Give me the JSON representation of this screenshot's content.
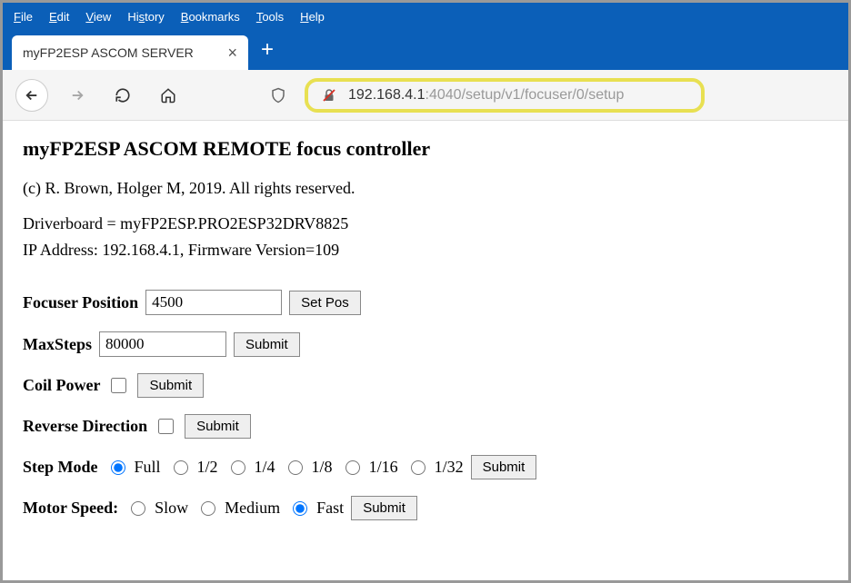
{
  "menu": {
    "file": "File",
    "edit": "Edit",
    "view": "View",
    "history": "History",
    "bookmarks": "Bookmarks",
    "tools": "Tools",
    "help": "Help"
  },
  "tab": {
    "title": "myFP2ESP ASCOM SERVER"
  },
  "url": {
    "host": "192.168.4.1",
    "path": ":4040/setup/v1/focuser/0/setup"
  },
  "page": {
    "heading": "myFP2ESP ASCOM REMOTE focus controller",
    "copyright": "(c) R. Brown, Holger M, 2019. All rights reserved.",
    "driverboard_line": "Driverboard = myFP2ESP.PRO2ESP32DRV8825",
    "ipfw_line": "IP Address: 192.168.4.1, Firmware Version=109"
  },
  "form": {
    "focuser_position": {
      "label": "Focuser Position",
      "value": "4500",
      "button": "Set Pos"
    },
    "max_steps": {
      "label": "MaxSteps",
      "value": "80000",
      "button": "Submit"
    },
    "coil_power": {
      "label": "Coil Power",
      "checked": false,
      "button": "Submit"
    },
    "reverse_direction": {
      "label": "Reverse Direction",
      "checked": false,
      "button": "Submit"
    },
    "step_mode": {
      "label": "Step Mode",
      "options": [
        "Full",
        "1/2",
        "1/4",
        "1/8",
        "1/16",
        "1/32"
      ],
      "selected": "Full",
      "button": "Submit"
    },
    "motor_speed": {
      "label": "Motor Speed:",
      "options": [
        "Slow",
        "Medium",
        "Fast"
      ],
      "selected": "Fast",
      "button": "Submit"
    }
  }
}
